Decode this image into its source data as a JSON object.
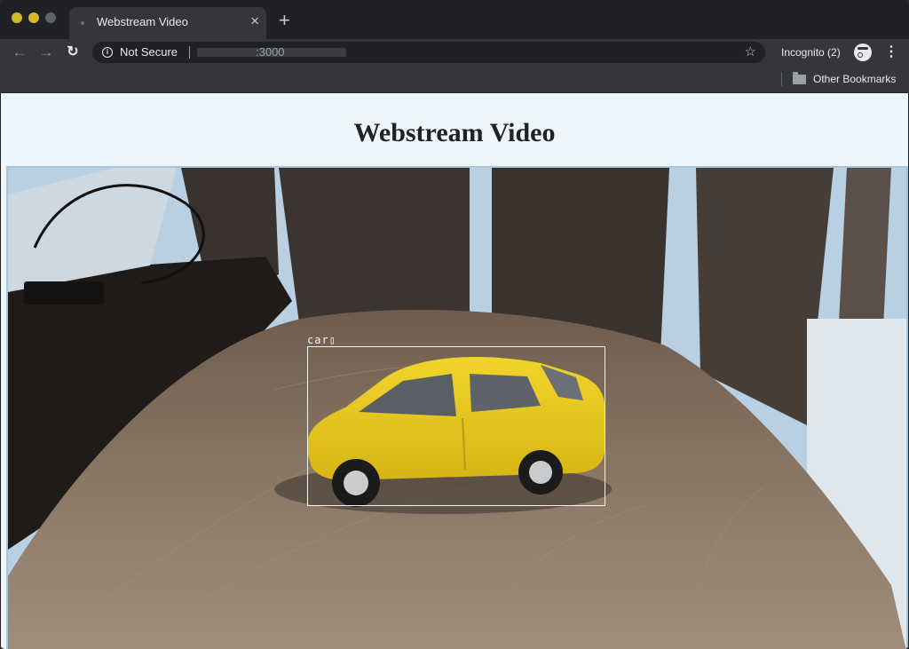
{
  "browser": {
    "tab_title": "Webstream Video",
    "tab_close": "×",
    "new_tab": "+",
    "security_label": "Not Secure",
    "url_port": ":3000",
    "profile_label": "Incognito (2)",
    "bookmark_label": "Other Bookmarks"
  },
  "page": {
    "title": "Webstream Video"
  },
  "video": {
    "detection_label": "car",
    "detection_label_box": "▯"
  },
  "colors": {
    "page_bg": "#eef6fb",
    "browser_chrome": "#35363a",
    "car_yellow": "#e6c51e",
    "table_wood": "#8a7765"
  }
}
